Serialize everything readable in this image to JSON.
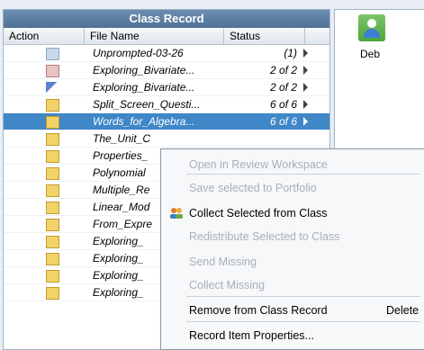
{
  "panel": {
    "title": "Class Record"
  },
  "columns": {
    "action": "Action",
    "file": "File Name",
    "status": "Status"
  },
  "rows": [
    {
      "icon": "folder",
      "name": "Unprompted-03-26",
      "status": "(1)"
    },
    {
      "icon": "x",
      "name": "Exploring_Bivariate...",
      "status": "2 of 2"
    },
    {
      "icon": "flag",
      "name": "Exploring_Bivariate...",
      "status": "2 of 2"
    },
    {
      "icon": "envelope",
      "name": "Split_Screen_Questi...",
      "status": "6 of 6"
    },
    {
      "icon": "envelope",
      "name": "Words_for_Algebra...",
      "status": "6 of 6"
    },
    {
      "icon": "envelope",
      "name": "The_Unit_C",
      "status": ""
    },
    {
      "icon": "envelope",
      "name": "Properties_",
      "status": ""
    },
    {
      "icon": "envelope",
      "name": "Polynomial",
      "status": ""
    },
    {
      "icon": "envelope",
      "name": "Multiple_Re",
      "status": ""
    },
    {
      "icon": "envelope",
      "name": "Linear_Mod",
      "status": ""
    },
    {
      "icon": "envelope",
      "name": "From_Expre",
      "status": ""
    },
    {
      "icon": "envelope",
      "name": "Exploring_",
      "status": ""
    },
    {
      "icon": "envelope",
      "name": "Exploring_",
      "status": ""
    },
    {
      "icon": "envelope",
      "name": "Exploring_",
      "status": ""
    },
    {
      "icon": "envelope",
      "name": "Exploring_",
      "status": ""
    }
  ],
  "student": {
    "name": "Deb"
  },
  "context_menu": {
    "items": [
      {
        "label": "Open in Review Workspace",
        "enabled": false
      },
      {
        "label": "Save selected to Portfolio",
        "enabled": false
      },
      {
        "label": "Collect Selected from Class",
        "enabled": true,
        "icon": "people-icon"
      },
      {
        "label": "Redistribute Selected to Class",
        "enabled": false
      },
      {
        "label": "Send Missing",
        "enabled": false
      },
      {
        "label": "Collect Missing",
        "enabled": false
      },
      {
        "label": "Remove from Class Record",
        "enabled": true,
        "shortcut": "Delete"
      },
      {
        "label": "Record Item Properties...",
        "enabled": true
      }
    ]
  }
}
